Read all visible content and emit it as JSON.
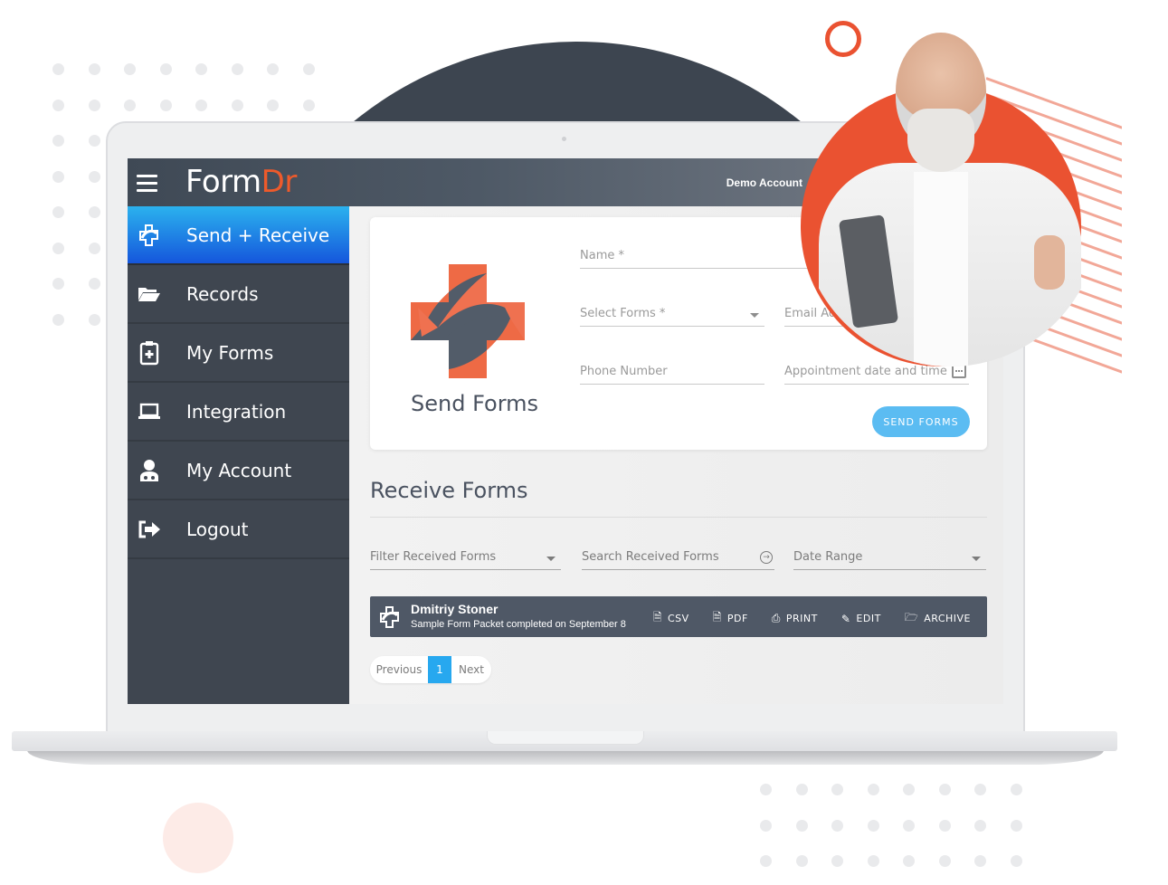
{
  "header": {
    "logo_part1": "Form",
    "logo_part2": "Dr",
    "account_label": "Demo Account"
  },
  "sidebar": {
    "items": [
      {
        "label": "Send + Receive",
        "icon": "send-receive-icon",
        "active": true
      },
      {
        "label": "Records",
        "icon": "folder-open-icon",
        "active": false
      },
      {
        "label": "My Forms",
        "icon": "clipboard-plus-icon",
        "active": false
      },
      {
        "label": "Integration",
        "icon": "laptop-icon",
        "active": false
      },
      {
        "label": "My Account",
        "icon": "doctor-user-icon",
        "active": false
      },
      {
        "label": "Logout",
        "icon": "logout-icon",
        "active": false
      }
    ]
  },
  "send_forms": {
    "title": "Send Forms",
    "fields": {
      "name_placeholder": "Name *",
      "select_forms_placeholder": "Select Forms *",
      "email_placeholder": "Email Address",
      "phone_placeholder": "Phone Number",
      "appointment_placeholder": "Appointment date and time"
    },
    "submit_label": "SEND FORMS"
  },
  "receive_forms": {
    "title": "Receive Forms",
    "filter_placeholder": "Filter Received Forms",
    "search_placeholder": "Search Received Forms",
    "date_range_placeholder": "Date Range",
    "records": [
      {
        "name": "Dmitriy Stoner",
        "description": "Sample Form Packet completed on September 8",
        "actions": [
          {
            "label": "CSV",
            "icon": "file-excel-icon"
          },
          {
            "label": "PDF",
            "icon": "file-pdf-icon"
          },
          {
            "label": "PRINT",
            "icon": "print-icon"
          },
          {
            "label": "EDIT",
            "icon": "edit-icon"
          },
          {
            "label": "ARCHIVE",
            "icon": "folder-open-icon"
          }
        ]
      }
    ],
    "pagination": {
      "previous_label": "Previous",
      "current_page": "1",
      "next_label": "Next"
    }
  },
  "colors": {
    "brand_orange": "#ee5a2b",
    "active_blue_top": "#2bb2ee",
    "active_blue_bottom": "#1556dc",
    "sidebar_bg": "#3f4650",
    "button_blue": "#5bbcf2",
    "dark_circle": "#3d4550"
  }
}
